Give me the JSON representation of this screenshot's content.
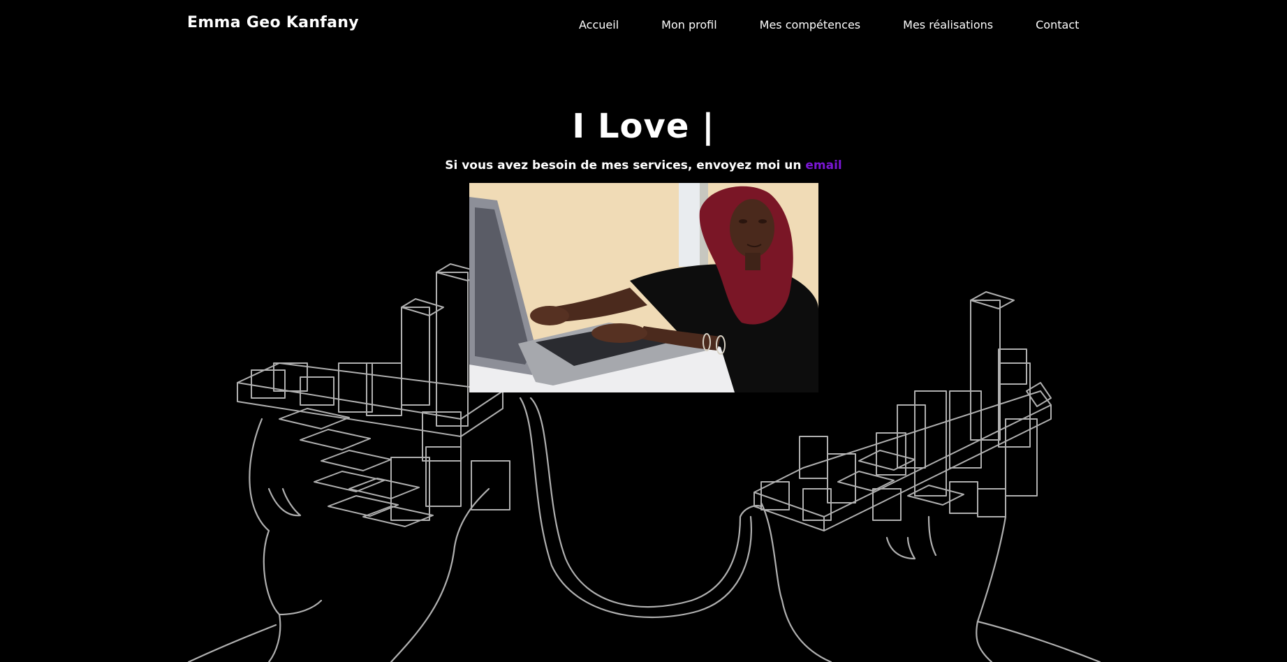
{
  "header": {
    "brand": "Emma Geo Kanfany",
    "nav": [
      {
        "label": "Accueil"
      },
      {
        "label": "Mon profil"
      },
      {
        "label": "Mes compétences"
      },
      {
        "label": "Mes réalisations"
      },
      {
        "label": "Contact"
      }
    ]
  },
  "hero": {
    "title": "I Love |",
    "subtitle_prefix": "Si vous avez besoin de mes services, envoyez moi un",
    "email_link": "email"
  },
  "colors": {
    "background": "#000000",
    "text": "#ffffff",
    "link_accent": "#7a16d4",
    "line_art": "#d9d9d9"
  }
}
